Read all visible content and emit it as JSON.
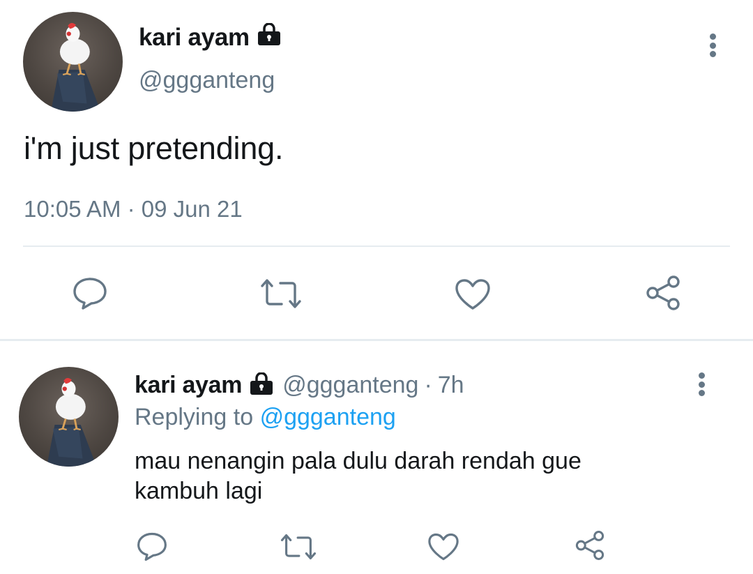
{
  "main_tweet": {
    "display_name": "kari ayam",
    "handle": "@ggganteng",
    "text": "i'm just pretending.",
    "time": "10:05 AM",
    "separator": "·",
    "date": "09 Jun 21",
    "icons": {
      "lock": "lock-icon",
      "more": "more-vertical-icon",
      "reply": "reply-icon",
      "retweet": "retweet-icon",
      "like": "heart-icon",
      "share": "share-icon"
    }
  },
  "reply_tweet": {
    "display_name": "kari ayam",
    "handle": "@ggganteng",
    "separator": "·",
    "time": "7h",
    "replying_prefix": "Replying to",
    "replying_to": "@ggganteng",
    "text": "mau nenangin pala dulu darah rendah gue kambuh lagi"
  },
  "colors": {
    "text_primary": "#14171a",
    "text_secondary": "#657786",
    "link": "#1da1f2",
    "divider": "#e6ecf0",
    "icon": "#657786"
  }
}
